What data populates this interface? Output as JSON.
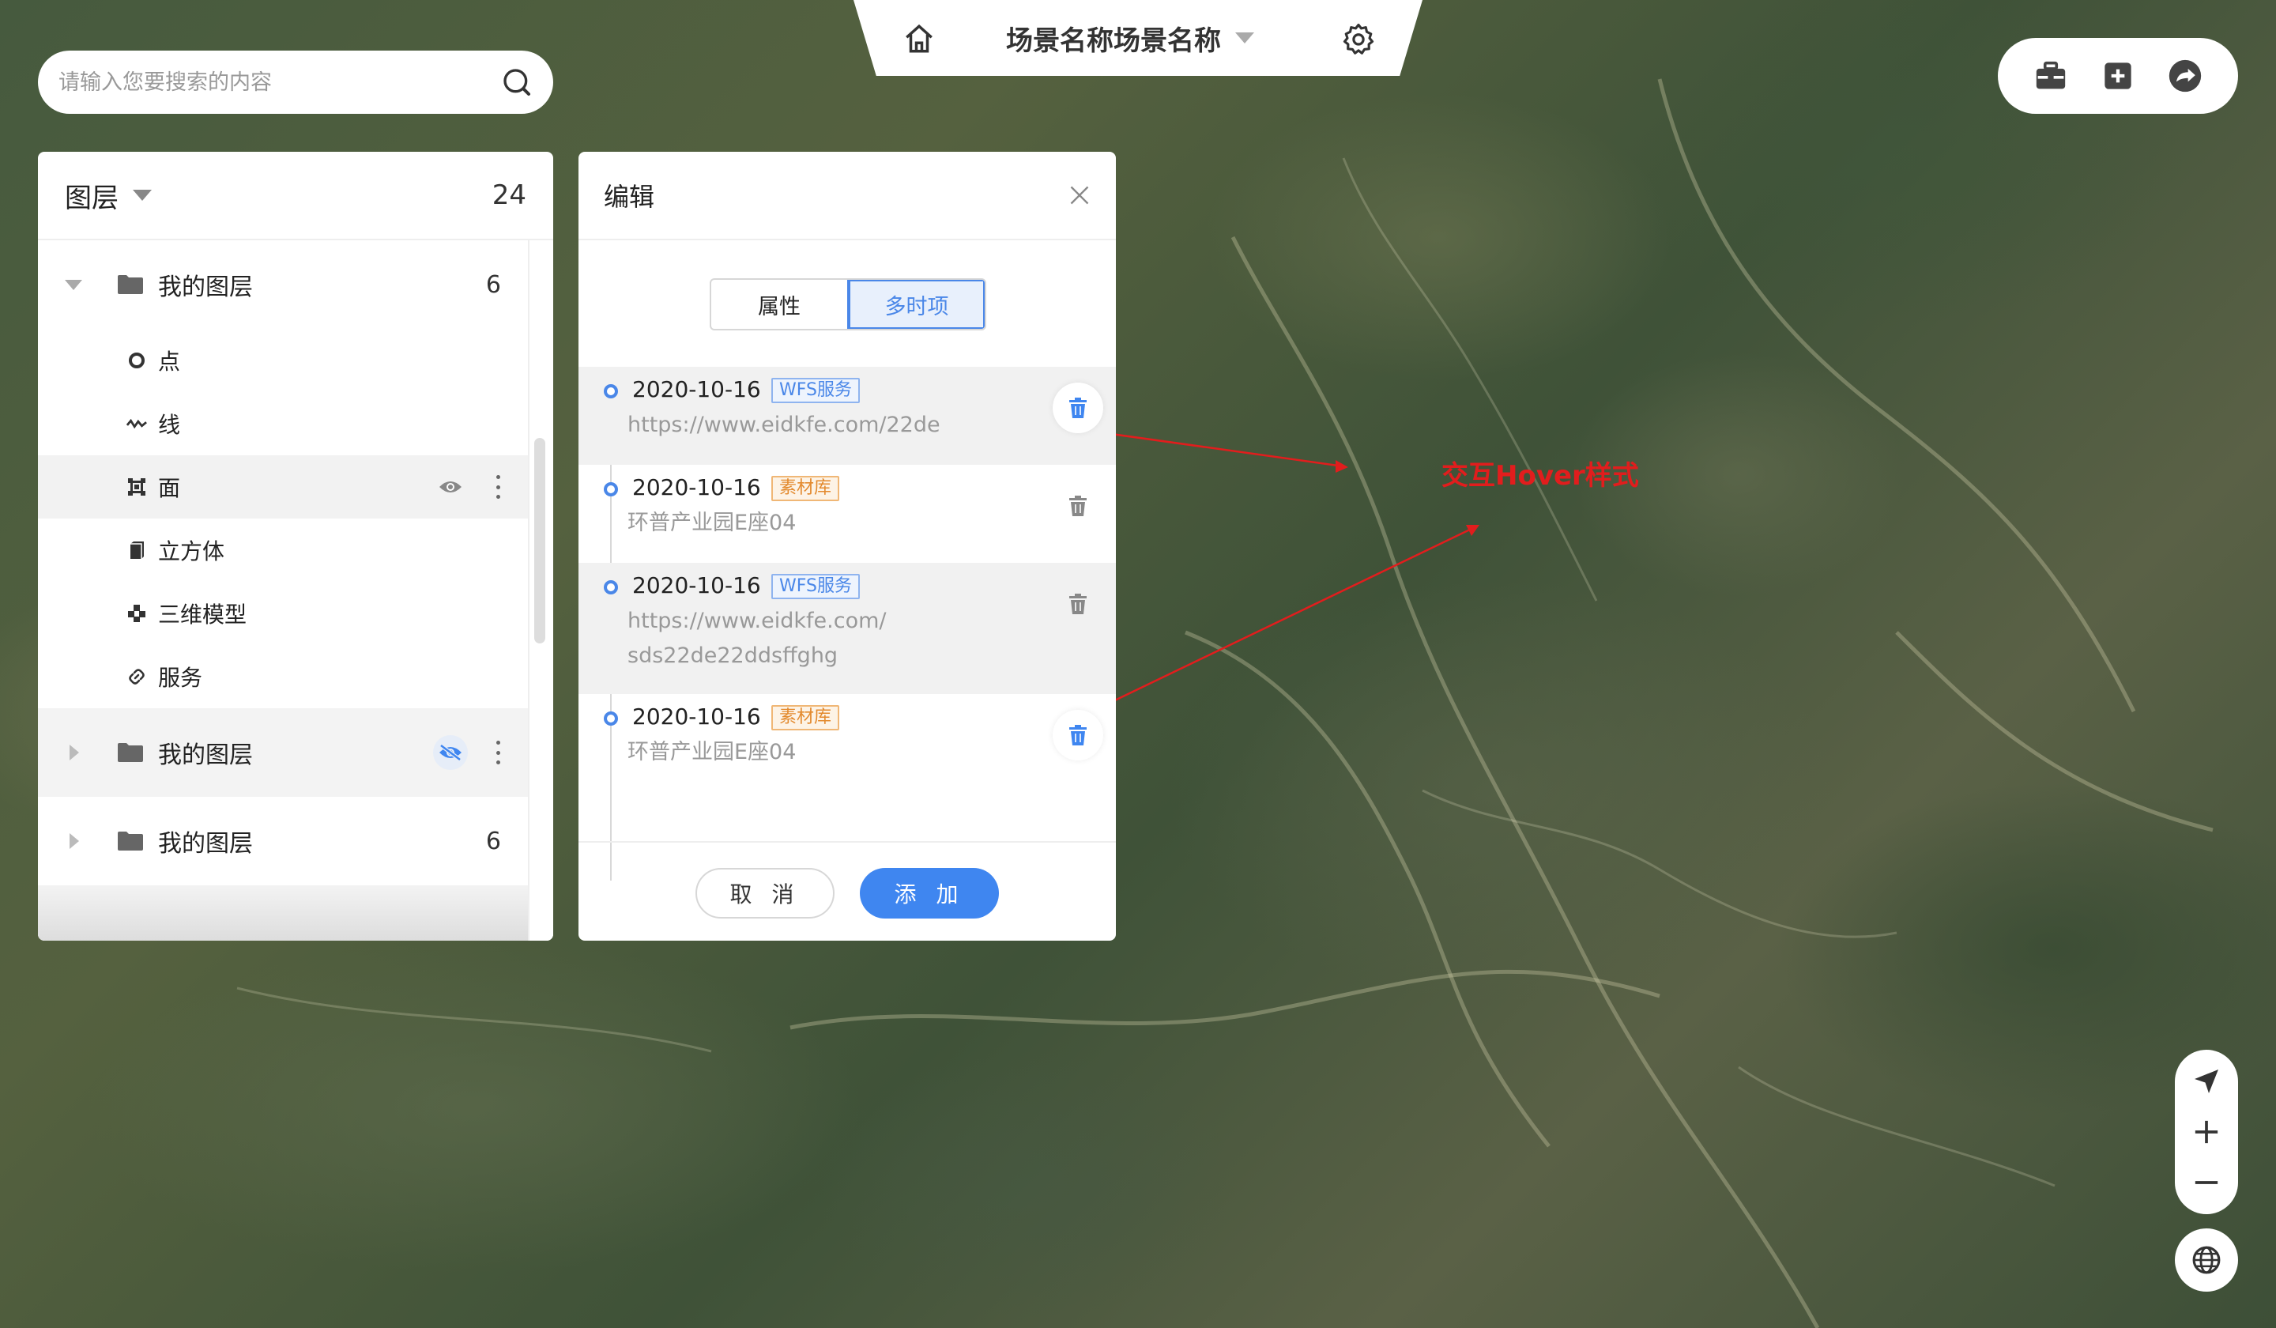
{
  "scene": {
    "title": "场景名称场景名称"
  },
  "search": {
    "placeholder": "请输入您要搜索的内容"
  },
  "layers": {
    "title": "图层",
    "count": "24",
    "groups": [
      {
        "label": "我的图层",
        "count": "6"
      },
      {
        "label": "我的图层"
      },
      {
        "label": "我的图层",
        "count": "6"
      }
    ],
    "children": [
      {
        "label": "点"
      },
      {
        "label": "线"
      },
      {
        "label": "面"
      },
      {
        "label": "立方体"
      },
      {
        "label": "三维模型"
      },
      {
        "label": "服务"
      }
    ]
  },
  "edit": {
    "title": "编辑",
    "tabs": [
      {
        "label": "属性"
      },
      {
        "label": "多时项"
      }
    ],
    "items": [
      {
        "date": "2020-10-16",
        "tag": "WFS服务",
        "line1": "https://www.eidkfe.com/22de"
      },
      {
        "date": "2020-10-16",
        "tag": "素材库",
        "line1": "环普产业园E座04"
      },
      {
        "date": "2020-10-16",
        "tag": "WFS服务",
        "line1": "https://www.eidkfe.com/",
        "line2": "sds22de22ddsffghg"
      },
      {
        "date": "2020-10-16",
        "tag": "素材库",
        "line1": "环普产业园E座04"
      }
    ],
    "cancel_label": "取 消",
    "ok_label": "添 加"
  },
  "annotation": {
    "text": "交互Hover样式"
  },
  "colors": {
    "accent": "#3f86f0",
    "tag_orange": "#e38a2e",
    "annotation": "#e21d1d"
  },
  "icons": [
    "home-icon",
    "gear-icon",
    "search-icon",
    "toolbox-icon",
    "plus-square-icon",
    "share-icon",
    "folder-icon",
    "eye-icon",
    "eye-off-icon",
    "trash-icon",
    "close-icon",
    "locate-icon",
    "zoom-in-icon",
    "zoom-out-icon",
    "globe-icon"
  ]
}
